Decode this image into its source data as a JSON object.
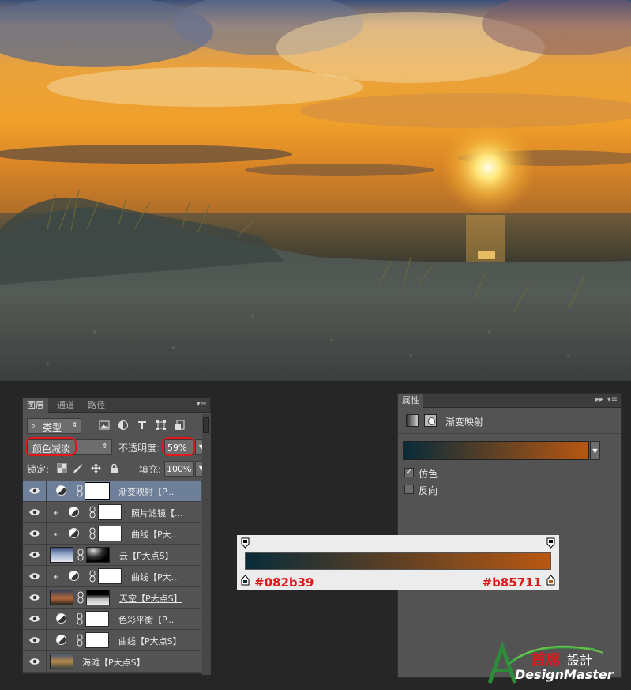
{
  "layers_panel": {
    "tabs": [
      {
        "label": "图层"
      },
      {
        "label": "通道"
      },
      {
        "label": "路径"
      }
    ],
    "menu_glyph": "▾≡",
    "filter": {
      "label": "类型",
      "icon": "search-icon"
    },
    "blend_mode": "颜色减淡",
    "opacity_label": "不透明度:",
    "opacity_value": "59%",
    "lock_label": "锁定:",
    "fill_label": "填充:",
    "fill_value": "100%",
    "layers": [
      {
        "name": "渐变映射【P...",
        "type": "adjustment",
        "selected": true,
        "clipped": false
      },
      {
        "name": "照片滤镜【...",
        "type": "adjustment",
        "selected": false,
        "clipped": true
      },
      {
        "name": "曲线【P大...",
        "type": "adjustment",
        "selected": false,
        "clipped": true
      },
      {
        "name": "云【P大点S】",
        "type": "image-mask",
        "selected": false,
        "clipped": false
      },
      {
        "name": "曲线【P大...",
        "type": "adjustment",
        "selected": false,
        "clipped": true
      },
      {
        "name": "天空【P大点S】",
        "type": "image-mask",
        "selected": false,
        "clipped": false
      },
      {
        "name": "色彩平衡【P...",
        "type": "adjustment",
        "selected": false,
        "clipped": false
      },
      {
        "name": "曲线【P大点S】",
        "type": "adjustment",
        "selected": false,
        "clipped": false
      },
      {
        "name": "海滩【P大点S】",
        "type": "image",
        "selected": false,
        "clipped": false
      }
    ]
  },
  "properties_panel": {
    "tab": "属性",
    "header_title": "渐变映射",
    "gradient": {
      "start_color": "#082b39",
      "end_color": "#b85711"
    },
    "dither_label": "仿色",
    "dither_checked": true,
    "reverse_label": "反向",
    "reverse_checked": false
  },
  "gradient_callout": {
    "left_hex": "#082b39",
    "right_hex": "#b85711"
  },
  "logo": {
    "cn_text": "首席",
    "tw_text": "設計",
    "en_text": "DesignMaster"
  },
  "colors": {
    "highlight_red": "#e3161c",
    "panel_bg": "#535353",
    "selected_row": "#6e7f9a"
  }
}
